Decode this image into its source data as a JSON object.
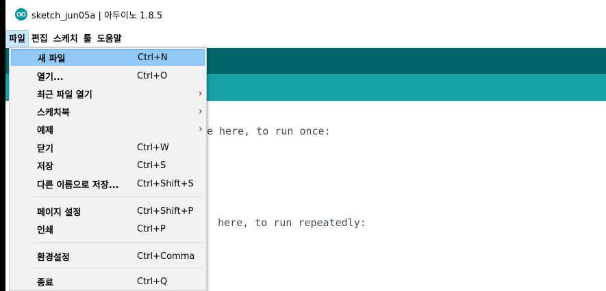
{
  "window": {
    "title": "sketch_jun05a | 아두이노 1.8.5",
    "logo_icon": "arduino-infinity-logo",
    "brand_color": "#00979c"
  },
  "menubar": {
    "items": [
      "파일",
      "편집",
      "스케치",
      "툴",
      "도움말"
    ]
  },
  "colors": {
    "toolbar": "#006468",
    "tabs": "#17a1a5",
    "menu_highlight": "#91c9f7"
  },
  "file_menu": {
    "items": [
      {
        "label": "새 파일",
        "shortcut": "Ctrl+N"
      },
      {
        "label": "열기...",
        "shortcut": "Ctrl+O"
      },
      {
        "label": "최근 파일 열기",
        "shortcut": "",
        "submenu_icon": "chevron-right-icon"
      },
      {
        "label": "스케치북",
        "shortcut": "",
        "submenu_icon": "chevron-right-icon"
      },
      {
        "label": "예제",
        "shortcut": "",
        "submenu_icon": "chevron-right-icon"
      },
      {
        "label": "닫기",
        "shortcut": "Ctrl+W"
      },
      {
        "label": "저장",
        "shortcut": "Ctrl+S"
      },
      {
        "label": "다른 이름으로 저장...",
        "shortcut": "Ctrl+Shift+S"
      },
      {
        "label": "페이지 설정",
        "shortcut": "Ctrl+Shift+P"
      },
      {
        "label": "인쇄",
        "shortcut": "Ctrl+P"
      },
      {
        "label": "환경설정",
        "shortcut": "Ctrl+Comma"
      },
      {
        "label": "종료",
        "shortcut": "Ctrl+Q"
      }
    ],
    "arrow_glyph": "›"
  },
  "editor": {
    "code_lines": [
      "e here, to run once:",
      " here, to run repeatedly:"
    ]
  }
}
